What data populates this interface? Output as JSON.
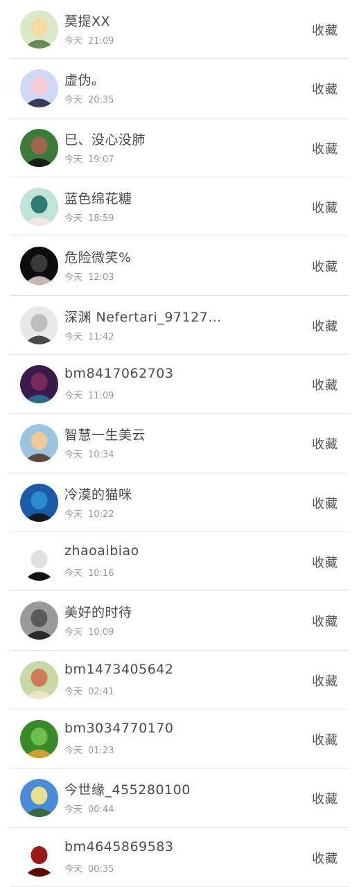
{
  "collect_label": "收藏",
  "day_label": "今天",
  "items": [
    {
      "name": "莫提XX",
      "time": "21:09",
      "avatar_icon": "cartoon-boy-avatar",
      "colors": [
        "#d9e9c8",
        "#f4d9a3",
        "#6a8a5a"
      ]
    },
    {
      "name": "虚伪。",
      "time": "20:35",
      "avatar_icon": "girl-photo-avatar",
      "colors": [
        "#cfd8f5",
        "#f6c9d4",
        "#3a3a5a"
      ]
    },
    {
      "name": "巳、没心没肺",
      "time": "19:07",
      "avatar_icon": "man-photo-avatar",
      "colors": [
        "#3d7a3a",
        "#a0664a",
        "#1c1c1c"
      ]
    },
    {
      "name": "蓝色绵花糖",
      "time": "18:59",
      "avatar_icon": "woman-teal-avatar",
      "colors": [
        "#bfe3d8",
        "#2f7a73",
        "#f2e6e0"
      ]
    },
    {
      "name": "危险微笑%",
      "time": "12:03",
      "avatar_icon": "dark-portrait-avatar",
      "colors": [
        "#0d0d0d",
        "#3a3a3a",
        "#c7b7b0"
      ]
    },
    {
      "name": "深渊 Nefertari_97127…",
      "time": "11:42",
      "avatar_icon": "bw-portrait-avatar",
      "colors": [
        "#e8e8e8",
        "#bdbdbd",
        "#4a4a4a"
      ]
    },
    {
      "name": "bm8417062703",
      "time": "11:09",
      "avatar_icon": "fantasy-hero-avatar",
      "colors": [
        "#3a1a4a",
        "#7a2a5a",
        "#2a6a8a"
      ]
    },
    {
      "name": "智慧一生美云",
      "time": "10:34",
      "avatar_icon": "mother-child-avatar",
      "colors": [
        "#9ac4e0",
        "#f0c89a",
        "#5a4a3a"
      ]
    },
    {
      "name": "冷漠的猫咪",
      "time": "10:22",
      "avatar_icon": "city-girl-avatar",
      "colors": [
        "#1a5aa8",
        "#2a8ad0",
        "#101820"
      ]
    },
    {
      "name": "zhaoaibiao",
      "time": "10:16",
      "avatar_icon": "sketch-man-avatar",
      "colors": [
        "#ffffff",
        "#e0e0e0",
        "#111111"
      ]
    },
    {
      "name": "美好的时待",
      "time": "10:09",
      "avatar_icon": "gray-street-avatar",
      "colors": [
        "#9a9a9a",
        "#5a5a5a",
        "#2a2a2a"
      ]
    },
    {
      "name": "bm1473405642",
      "time": "02:41",
      "avatar_icon": "food-plate-avatar",
      "colors": [
        "#c8d8a8",
        "#d07a5a",
        "#f0e0c8"
      ]
    },
    {
      "name": "bm3034770170",
      "time": "01:23",
      "avatar_icon": "mushroom-grass-avatar",
      "colors": [
        "#3a8a2a",
        "#6ac04a",
        "#d0a030"
      ]
    },
    {
      "name": "今世缘_455280100",
      "time": "00:44",
      "avatar_icon": "landscape-field-avatar",
      "colors": [
        "#4a8ad8",
        "#e8e090",
        "#3a6a3a"
      ]
    },
    {
      "name": "bm4645869583",
      "time": "00:35",
      "avatar_icon": "red-hat-avatar",
      "colors": [
        "#ffffff",
        "#9a1a1a",
        "#5a0a0a"
      ]
    }
  ]
}
